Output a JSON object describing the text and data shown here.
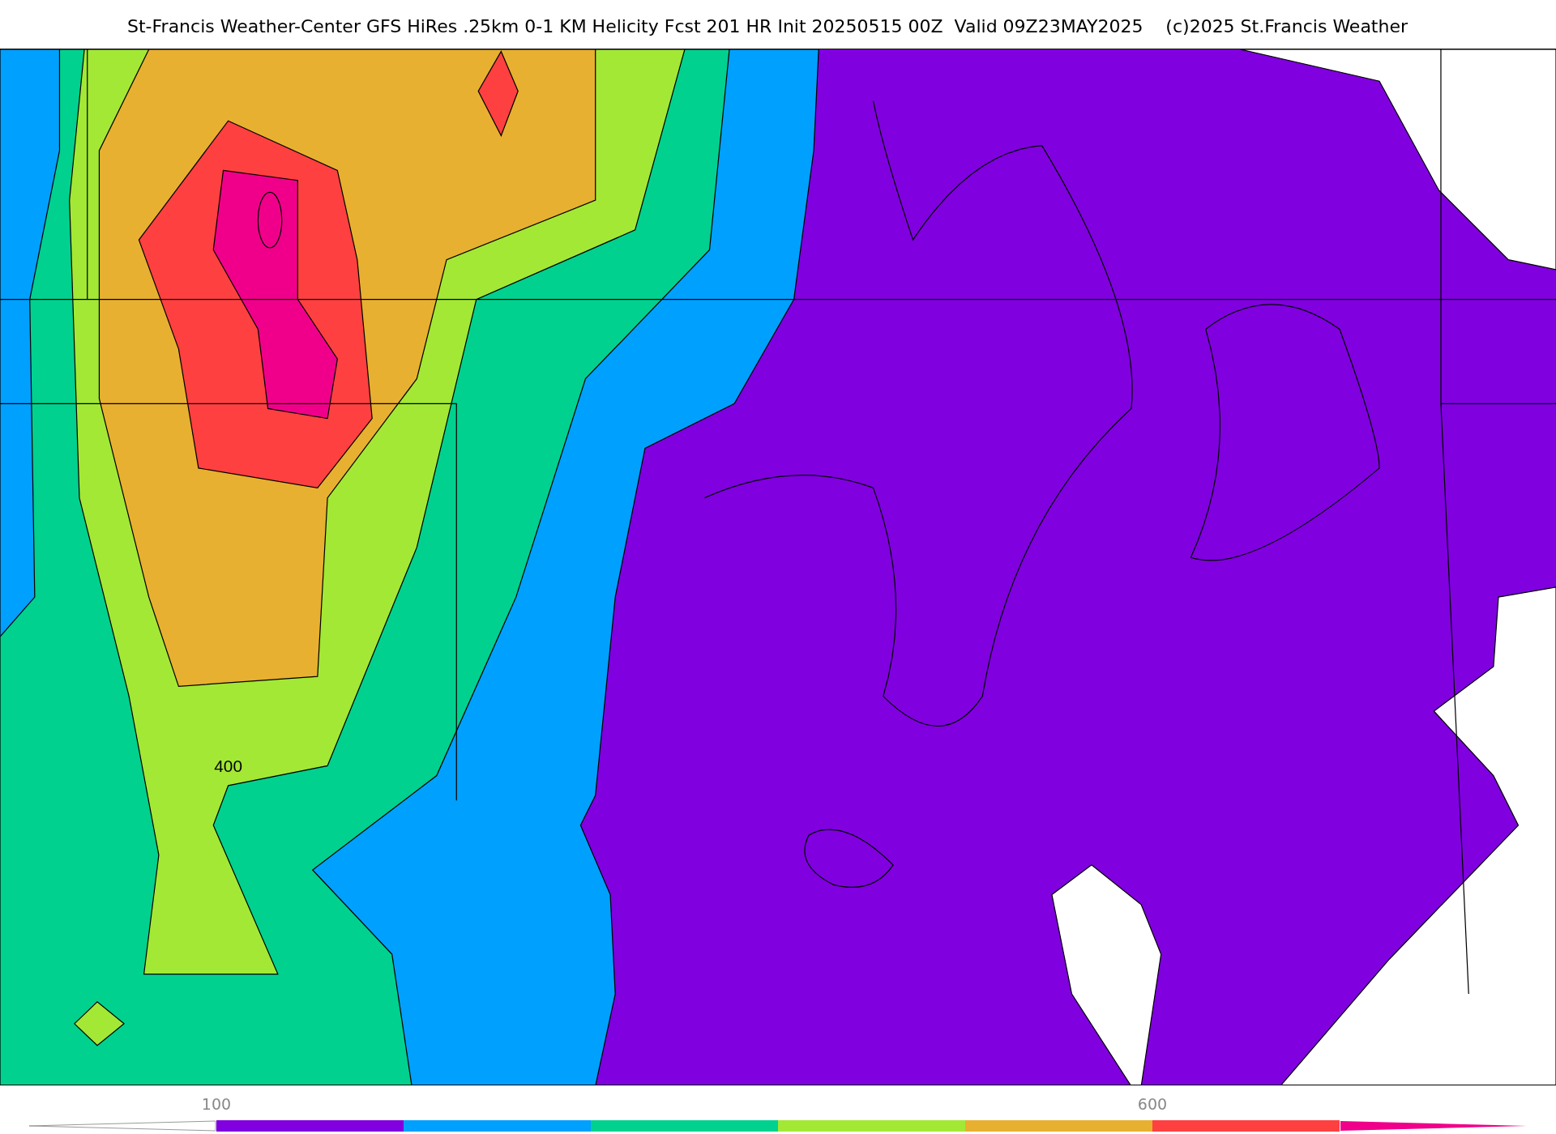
{
  "title": "St-Francis Weather-Center GFS HiRes .25km 0-1 KM Helicity Fcst 201 HR Init 20250515 00Z  Valid 09Z23MAY2025    (c)2025 St.Francis Weather",
  "map": {
    "contour_label": "400"
  },
  "colorbar": {
    "bands": [
      {
        "kind": "low-extension",
        "color": "#ffffff"
      },
      {
        "kind": "band",
        "color": "#8000e0",
        "tick": "100"
      },
      {
        "kind": "band",
        "color": "#00a0ff"
      },
      {
        "kind": "band",
        "color": "#00d18e"
      },
      {
        "kind": "band",
        "color": "#a3e835"
      },
      {
        "kind": "band",
        "color": "#e8b030"
      },
      {
        "kind": "band",
        "color": "#ff4040",
        "tick": "600"
      },
      {
        "kind": "high-extension",
        "color": "#f0008a"
      }
    ]
  }
}
